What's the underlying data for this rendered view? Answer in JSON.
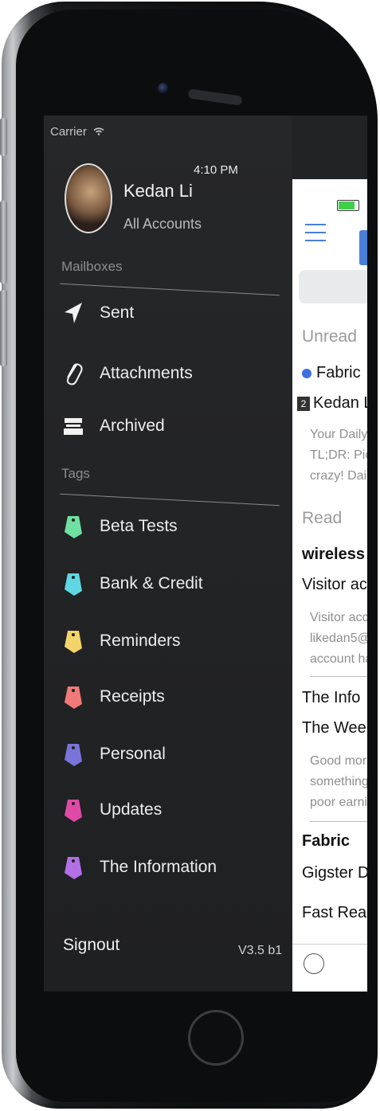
{
  "status": {
    "carrier": "Carrier",
    "time": "4:10 PM"
  },
  "user": {
    "name": "Kedan Li",
    "subtitle": "All Accounts"
  },
  "sections": {
    "mailboxes": "Mailboxes",
    "tags": "Tags"
  },
  "mailboxes": [
    {
      "label": "Sent",
      "icon": "send-icon"
    },
    {
      "label": "Attachments",
      "icon": "paperclip-icon"
    },
    {
      "label": "Archived",
      "icon": "archive-icon"
    }
  ],
  "tags": [
    {
      "label": "Beta Tests",
      "color": "#6fe1a1"
    },
    {
      "label": "Bank & Credit",
      "color": "#5fd7e2"
    },
    {
      "label": "Reminders",
      "color": "#f3d46a"
    },
    {
      "label": "Receipts",
      "color": "#f07a78"
    },
    {
      "label": "Personal",
      "color": "#7b74d8"
    },
    {
      "label": "Updates",
      "color": "#e04aa6"
    },
    {
      "label": "The Information",
      "color": "#b36fe6"
    }
  ],
  "footer": {
    "signout": "Signout",
    "version": "V3.5 b1"
  },
  "list": {
    "unread_header": "Unread",
    "read_header": "Read",
    "items": [
      {
        "sender": "Fabric",
        "count": "2",
        "subject": "Kedan Li",
        "preview1": "Your Daily",
        "preview2": "TL;DR: Pic",
        "preview3": "crazy! Dai"
      },
      {
        "sender": "wireless",
        "subject": "Visitor ac",
        "preview1": "Visitor acc",
        "preview2": "likedan5@",
        "preview3": "account ha"
      },
      {
        "sender": "The Info",
        "subject": "The Wee",
        "preview1": "Good mor",
        "preview2": "something",
        "preview3": "poor earni"
      },
      {
        "sender": "Fabric",
        "subject": "Gigster D"
      },
      {
        "sender": "Fast Read"
      }
    ]
  }
}
